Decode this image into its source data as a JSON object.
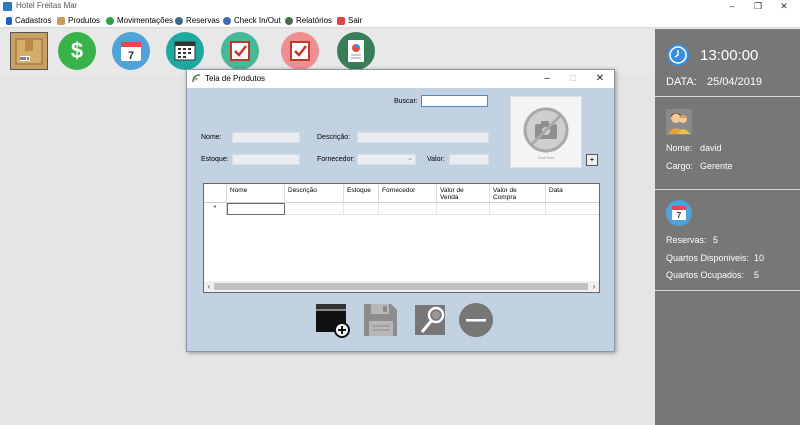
{
  "window": {
    "title": "Hotel Freitas Mar"
  },
  "menu": [
    {
      "label": "Cadastros",
      "icon": "bookmark-icon",
      "color": "#1d62c6"
    },
    {
      "label": "Produtos",
      "icon": "products-icon",
      "color": "#c79c5a"
    },
    {
      "label": "Movimentações",
      "icon": "money-icon",
      "color": "#2ba44a"
    },
    {
      "label": "Reservas",
      "icon": "calendar-icon",
      "color": "#3d6b88"
    },
    {
      "label": "Check In/Out",
      "icon": "check-icon",
      "color": "#3b6bb0"
    },
    {
      "label": "Relatórios",
      "icon": "report-icon",
      "color": "#4b6b4b"
    },
    {
      "label": "Sair",
      "icon": "exit-icon",
      "color": "#e04545"
    }
  ],
  "toolbar": [
    {
      "icon": "box-icon"
    },
    {
      "icon": "money-icon",
      "glyph": "$",
      "color": "#39b24a"
    },
    {
      "icon": "calendar-icon",
      "glyph": "7",
      "color": "#4fa3d9"
    },
    {
      "icon": "schedule-icon",
      "color": "#1fa9a0"
    },
    {
      "icon": "checkin-icon",
      "color": "#49b896"
    },
    {
      "icon": "checkout-icon",
      "color": "#ef8f94"
    },
    {
      "icon": "report-icon",
      "color": "#3a7d5a"
    }
  ],
  "status": {
    "time": "13:00:00",
    "date_label": "DATA:",
    "date": "25/04/2019",
    "name_label": "Nome:",
    "name": "david",
    "role_label": "Cargo:",
    "role": "Gerente",
    "reservas_label": "Reservas:",
    "reservas": "5",
    "disponiveis_label": "Quartos Disponiveis:",
    "disponiveis": "10",
    "ocupados_label": "Quartos Ocupados:",
    "ocupados": "5"
  },
  "dialog": {
    "title": "Tela de Produtos",
    "buscar_label": "Buscar:",
    "buscar_value": "",
    "nome_label": "Nome:",
    "descricao_label": "Descrição:",
    "estoque_label": "Estoque:",
    "fornecedor_label": "Fornecedor:",
    "valor_label": "Valor:",
    "photo_caption": "Sem foto",
    "add_photo": "+",
    "columns": [
      "Nome",
      "Descrição",
      "Estoque",
      "Fornecedor",
      "Valor de\nVenda",
      "Valor de\nCompra",
      "Data"
    ],
    "new_row_marker": "*",
    "actions": [
      "add-product-icon",
      "save-icon",
      "edit-search-icon",
      "delete-icon"
    ]
  }
}
